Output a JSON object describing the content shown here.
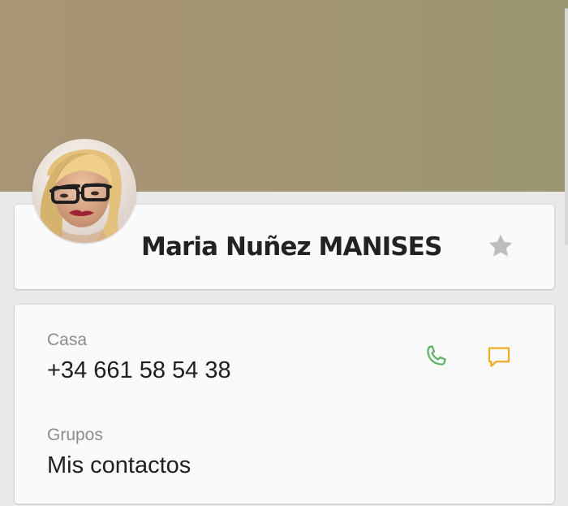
{
  "contact": {
    "name": "Maria Nuñez MANISES"
  },
  "phone": {
    "label": "Casa",
    "number": "+34 661 58 54 38"
  },
  "groups": {
    "label": "Grupos",
    "value": "Mis contactos"
  },
  "icons": {
    "favorite": "star-icon",
    "call": "phone-icon",
    "message": "message-icon"
  },
  "colors": {
    "header_background": "#a39573",
    "star": "#bdbdbd",
    "call": "#5fb16a",
    "message": "#f0ac26"
  }
}
